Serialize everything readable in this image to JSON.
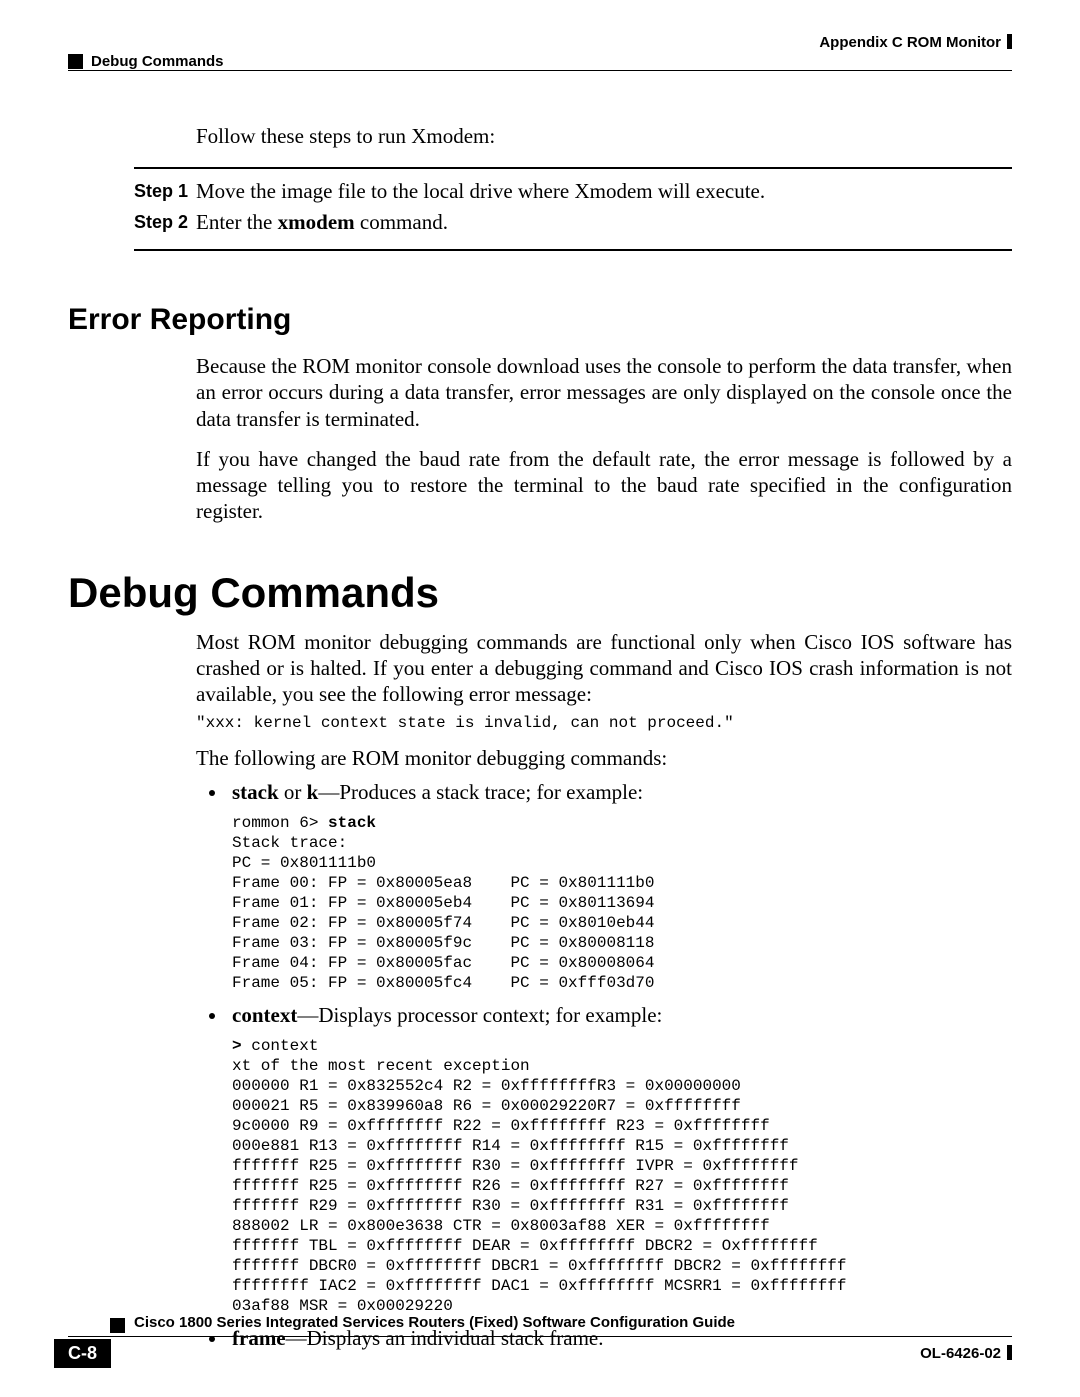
{
  "header": {
    "right": "Appendix C     ROM Monitor",
    "left": "Debug Commands"
  },
  "intro": "Follow these steps to run Xmodem:",
  "steps": {
    "s1_label": "Step 1",
    "s1_text_a": "Move the image file to the local drive where Xmodem will execute.",
    "s2_label": "Step 2",
    "s2_prefix": "Enter the ",
    "s2_bold": "xmodem",
    "s2_suffix": " command."
  },
  "error_reporting": {
    "title": "Error Reporting",
    "p1": "Because the ROM monitor console download uses the console to perform the data transfer, when an error occurs during a data transfer, error messages are only displayed on the console once the data transfer is terminated.",
    "p2": "If you have changed the baud rate from the default rate, the error message is followed by a message telling you to restore the terminal to the baud rate specified in the configuration register."
  },
  "debug": {
    "title": "Debug Commands",
    "p1": "Most ROM monitor debugging commands are functional only when Cisco IOS software has crashed or is halted. If you enter a debugging command and Cisco IOS crash information is not available, you see the following error message:",
    "err": "\"xxx: kernel context state is invalid, can not proceed.\"",
    "p2": "The following are ROM monitor debugging commands:",
    "b1_bold": "stack",
    "b1_mid": " or ",
    "b1_bold2": "k",
    "b1_rest": "—Produces a stack trace; for example:",
    "stack_code": "rommon 6> stack\nStack trace:\nPC = 0x801111b0\nFrame 00: FP = 0x80005ea8    PC = 0x801111b0\nFrame 01: FP = 0x80005eb4    PC = 0x80113694\nFrame 02: FP = 0x80005f74    PC = 0x8010eb44\nFrame 03: FP = 0x80005f9c    PC = 0x80008118\nFrame 04: FP = 0x80005fac    PC = 0x80008064\nFrame 05: FP = 0x80005fc4    PC = 0xfff03d70",
    "stack_bold": "stack",
    "b2_bold": "context",
    "b2_rest": "—Displays processor context; for example:",
    "context_code": "> context\nxt of the most recent exception\n000000 R1 = 0x832552c4 R2 = 0xffffffffR3 = 0x00000000\n000021 R5 = 0x839960a8 R6 = 0x00029220R7 = 0xffffffff\n9c0000 R9 = 0xffffffff R22 = 0xffffffff R23 = 0xffffffff\n000e881 R13 = 0xffffffff R14 = 0xffffffff R15 = 0xffffffff\nfffffff R25 = 0xffffffff R30 = 0xffffffff IVPR = 0xffffffff\nfffffff R25 = 0xffffffff R26 = 0xffffffff R27 = 0xffffffff\nfffffff R29 = 0xffffffff R30 = 0xffffffff R31 = 0xffffffff\n888002 LR = 0x800e3638 CTR = 0x8003af88 XER = 0xffffffff\nfffffff TBL = 0xffffffff DEAR = 0xffffffff DBCR2 = Oxffffffff\nfffffff DBCR0 = 0xffffffff DBCR1 = 0xffffffff DBCR2 = 0xffffffff\nffffffff IAC2 = 0xffffffff DAC1 = 0xffffffff MCSRR1 = 0xffffffff\n03af88 MSR = 0x00029220",
    "b3_bold": "frame",
    "b3_rest": "—Displays an individual stack frame."
  },
  "footer": {
    "title": "Cisco 1800 Series Integrated Services Routers (Fixed) Software Configuration Guide",
    "page": "C-8",
    "doc": "OL-6426-02"
  }
}
